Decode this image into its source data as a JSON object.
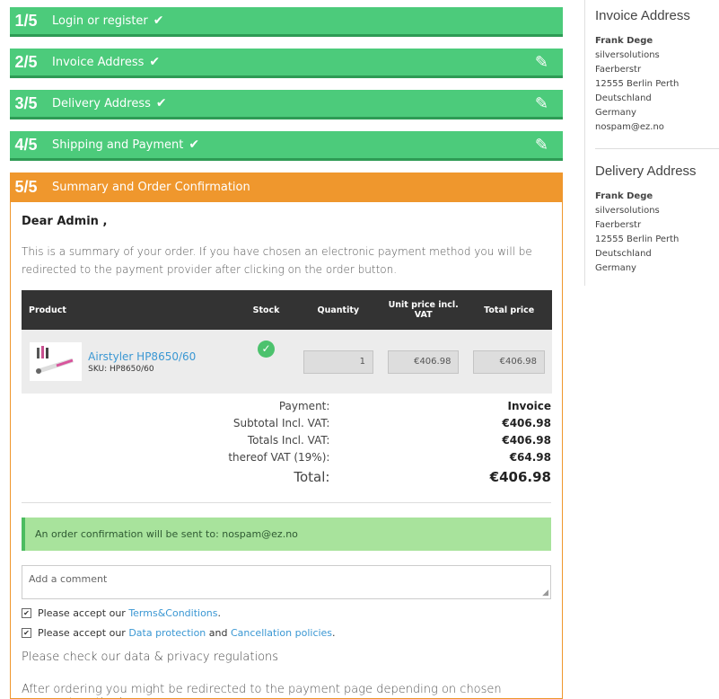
{
  "steps": [
    {
      "num": "1/5",
      "title": "Login or register",
      "check": "✔",
      "edit": ""
    },
    {
      "num": "2/5",
      "title": "Invoice Address",
      "check": "✔",
      "edit": "✎"
    },
    {
      "num": "3/5",
      "title": "Delivery Address",
      "check": "✔",
      "edit": "✎"
    },
    {
      "num": "4/5",
      "title": "Shipping and Payment",
      "check": "✔",
      "edit": "✎"
    },
    {
      "num": "5/5",
      "title": "Summary and Order Confirmation",
      "check": "",
      "edit": ""
    }
  ],
  "summary": {
    "greeting": "Dear Admin ,",
    "intro": "This is a summary of your order. If you have chosen an electronic payment method you will be redirected to the payment provider after clicking on the order button."
  },
  "cart": {
    "headers": [
      "Product",
      "Stock",
      "Quantity",
      "Unit price incl. VAT",
      "Total price"
    ],
    "item": {
      "name": "Airstyler HP8650/60",
      "sku": "SKU: HP8650/60",
      "quantity": "1",
      "unit_price": "€406.98",
      "total_price": "€406.98"
    }
  },
  "totals": {
    "payment_label": "Payment:",
    "payment_value": "Invoice",
    "subtotal_label": "Subtotal Incl. VAT:",
    "subtotal_value": "€406.98",
    "totals_label": "Totals Incl. VAT:",
    "totals_value": "€406.98",
    "vat_label": "thereof VAT (19%):",
    "vat_value": "€64.98",
    "total_label": "Total:",
    "total_value": "€406.98"
  },
  "notice": "An order confirmation will be sent to: nospam@ez.no",
  "comment_placeholder": "Add a comment",
  "terms": {
    "prefix": "Please accept our ",
    "link": "Terms&Conditions",
    "suffix": "."
  },
  "privacy_check": {
    "prefix": "Please accept our ",
    "link1": "Data protection",
    "mid": " and ",
    "link2": "Cancellation policies",
    "suffix": "."
  },
  "privacy_text": "Please check our data & privacy regulations",
  "after_text": "After ordering you might be redirected to the payment page depending on chosen payment method.",
  "invoice": {
    "title": "Invoice Address",
    "name": "Frank Dege",
    "lines": [
      "silversolutions",
      "Faerberstr",
      "12555 Berlin Perth",
      "Deutschland",
      "Germany",
      "nospam@ez.no"
    ]
  },
  "delivery": {
    "title": "Delivery Address",
    "name": "Frank Dege",
    "lines": [
      "silversolutions",
      "Faerberstr",
      "12555 Berlin Perth",
      "Deutschland",
      "Germany"
    ]
  },
  "colors": {
    "step_done": "#4ccb7b",
    "step_active": "#ef972d",
    "link": "#3a97d3"
  }
}
